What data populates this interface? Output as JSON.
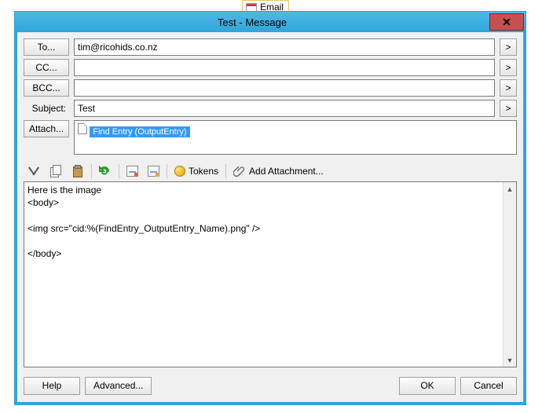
{
  "tag": {
    "label": "Email"
  },
  "title": "Test - Message",
  "fields": {
    "to_btn": "To...",
    "to_value": "tim@ricohids.co.nz",
    "cc_btn": "CC...",
    "cc_value": "",
    "bcc_btn": "BCC...",
    "bcc_value": "",
    "subject_label": "Subject:",
    "subject_value": "Test",
    "attach_btn": "Attach...",
    "attach_item": "Find Entry (OutputEntry)",
    "expand": ">"
  },
  "toolbar": {
    "tokens": "Tokens",
    "add_attachment": "Add Attachment..."
  },
  "body_text": "Here is the image\n<body>\n\n<img src=\"cid:%(FindEntry_OutputEntry_Name).png\" />\n\n</body>",
  "footer": {
    "help": "Help",
    "advanced": "Advanced...",
    "ok": "OK",
    "cancel": "Cancel"
  }
}
